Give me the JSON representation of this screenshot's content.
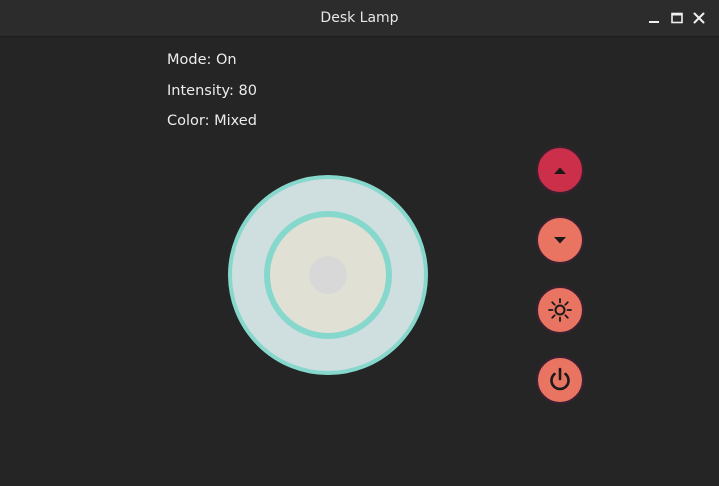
{
  "window": {
    "title": "Desk Lamp",
    "controls": [
      "minimize-icon",
      "maximize-icon",
      "close-icon"
    ]
  },
  "status": {
    "mode": "Mode: On",
    "intensity": "Intensity: 80",
    "color": "Color: Mixed"
  },
  "lamp": {
    "outer_fill": "#cfdfdf",
    "ring_color": "#86d8cd",
    "inner_fill": "#e0e0d4",
    "center_fill": "#d8d8d8"
  },
  "buttons": [
    {
      "name": "increase-intensity-button",
      "icon": "triangle-up-icon",
      "color": "#cc2f4a"
    },
    {
      "name": "decrease-intensity-button",
      "icon": "triangle-down-icon",
      "color": "#ea7462"
    },
    {
      "name": "light-button",
      "icon": "sun-icon",
      "color": "#ea7462"
    },
    {
      "name": "power-button",
      "icon": "power-icon",
      "color": "#ea7462"
    }
  ]
}
